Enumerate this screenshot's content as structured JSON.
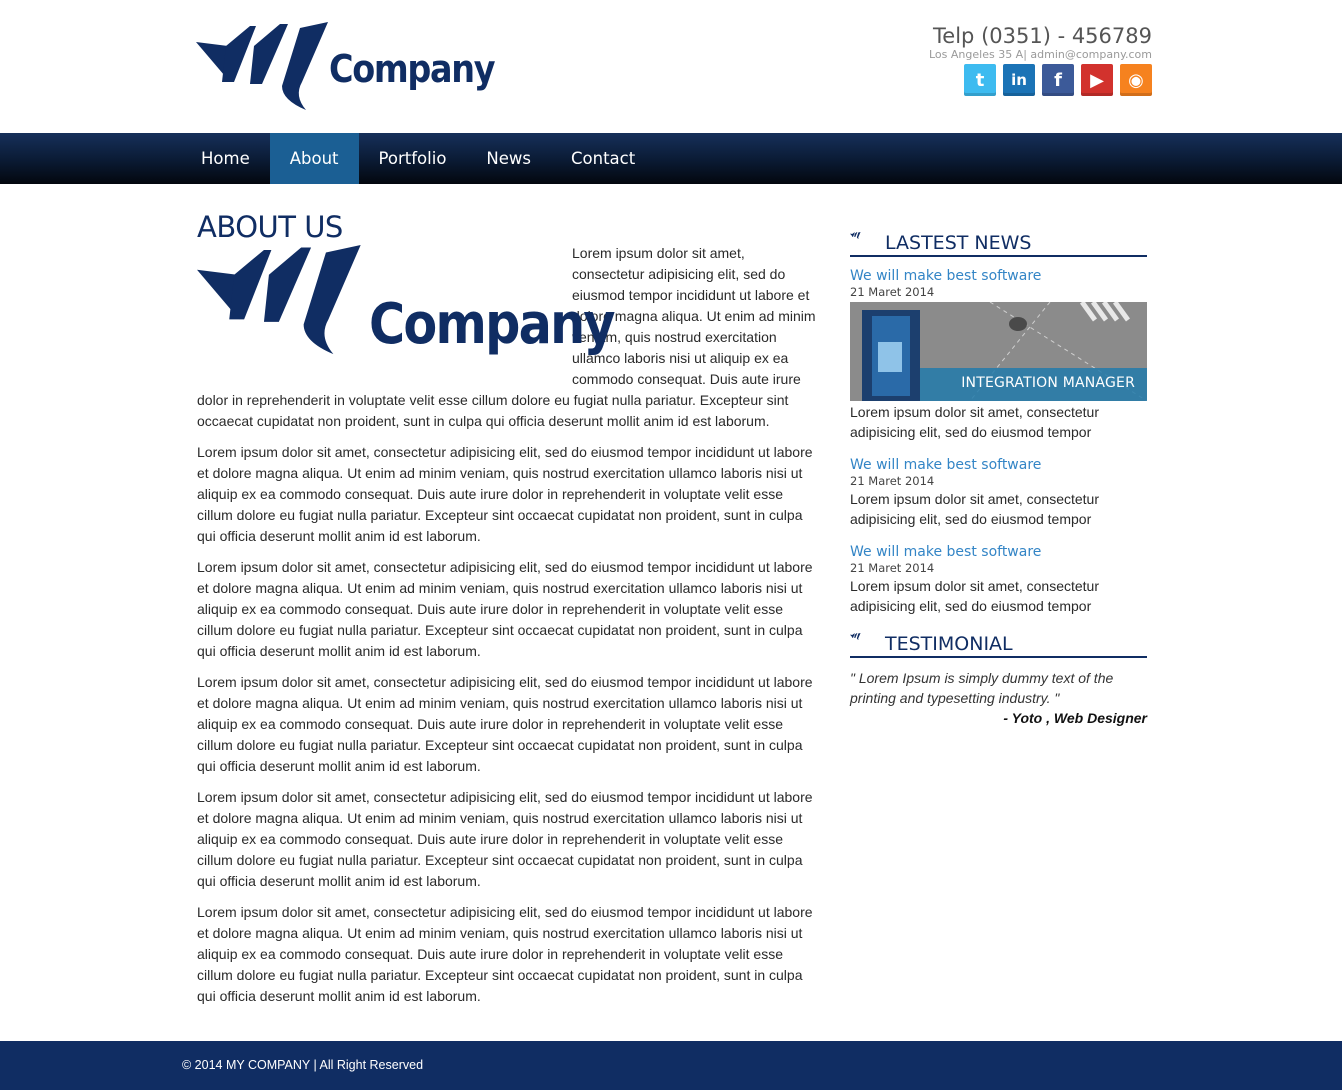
{
  "brand": {
    "name": "Company"
  },
  "header": {
    "phone": "Telp (0351) - 456789",
    "address": "Los Angeles 35 A| admin@company.com",
    "social": [
      {
        "icon": "twitter-icon",
        "glyph": "t",
        "color": "#3dbbf0"
      },
      {
        "icon": "linkedin-icon",
        "glyph": "in",
        "color": "#1b73b6"
      },
      {
        "icon": "facebook-icon",
        "glyph": "f",
        "color": "#3c5a99"
      },
      {
        "icon": "youtube-icon",
        "glyph": "▶",
        "color": "#d2322d"
      },
      {
        "icon": "rss-icon",
        "glyph": "◉",
        "color": "#f6821f"
      }
    ]
  },
  "nav": {
    "items": [
      {
        "label": "Home"
      },
      {
        "label": "About",
        "active": true
      },
      {
        "label": "Portfolio"
      },
      {
        "label": "News"
      },
      {
        "label": "Contact"
      }
    ]
  },
  "main": {
    "title": "ABOUT US",
    "paragraphs": [
      "Lorem ipsum dolor sit amet, consectetur adipisicing elit, sed do eiusmod tempor incididunt ut labore et dolore magna aliqua. Ut enim ad minim veniam, quis nostrud exercitation ullamco laboris nisi ut aliquip ex ea commodo consequat. Duis aute irure dolor in reprehenderit in voluptate velit esse cillum dolore eu fugiat nulla pariatur. Excepteur sint occaecat cupidatat non proident, sunt in culpa qui officia deserunt mollit anim id est laborum.",
      "Lorem ipsum dolor sit amet, consectetur adipisicing elit, sed do eiusmod tempor incididunt ut labore et dolore magna aliqua. Ut enim ad minim veniam, quis nostrud exercitation ullamco laboris nisi ut aliquip ex ea commodo consequat. Duis aute irure dolor in reprehenderit in voluptate velit esse cillum dolore eu fugiat nulla pariatur. Excepteur sint occaecat cupidatat non proident, sunt in culpa qui officia deserunt mollit anim id est laborum.",
      "Lorem ipsum dolor sit amet, consectetur adipisicing elit, sed do eiusmod tempor incididunt ut labore et dolore magna aliqua. Ut enim ad minim veniam, quis nostrud exercitation ullamco laboris nisi ut aliquip ex ea commodo consequat. Duis aute irure dolor in reprehenderit in voluptate velit esse cillum dolore eu fugiat nulla pariatur. Excepteur sint occaecat cupidatat non proident, sunt in culpa qui officia deserunt mollit anim id est laborum.",
      "Lorem ipsum dolor sit amet, consectetur adipisicing elit, sed do eiusmod tempor incididunt ut labore et dolore magna aliqua. Ut enim ad minim veniam, quis nostrud exercitation ullamco laboris nisi ut aliquip ex ea commodo consequat. Duis aute irure dolor in reprehenderit in voluptate velit esse cillum dolore eu fugiat nulla pariatur. Excepteur sint occaecat cupidatat non proident, sunt in culpa qui officia deserunt mollit anim id est laborum.",
      "Lorem ipsum dolor sit amet, consectetur adipisicing elit, sed do eiusmod tempor incididunt ut labore et dolore magna aliqua. Ut enim ad minim veniam, quis nostrud exercitation ullamco laboris nisi ut aliquip ex ea commodo consequat. Duis aute irure dolor in reprehenderit in voluptate velit esse cillum dolore eu fugiat nulla pariatur. Excepteur sint occaecat cupidatat non proident, sunt in culpa qui officia deserunt mollit anim id est laborum.",
      "Lorem ipsum dolor sit amet, consectetur adipisicing elit, sed do eiusmod tempor incididunt ut labore et dolore magna aliqua. Ut enim ad minim veniam, quis nostrud exercitation ullamco laboris nisi ut aliquip ex ea commodo consequat. Duis aute irure dolor in reprehenderit in voluptate velit esse cillum dolore eu fugiat nulla pariatur. Excepteur sint occaecat cupidatat non proident, sunt in culpa qui officia deserunt mollit anim id est laborum."
    ]
  },
  "sidebar": {
    "news_heading": "LASTEST NEWS",
    "news": [
      {
        "title": "We will make best software",
        "date": "21 Maret 2014",
        "excerpt": "Lorem ipsum dolor sit amet, consectetur adipisicing elit, sed do eiusmod tempor",
        "banner_caption": "INTEGRATION MANAGER"
      },
      {
        "title": "We will make best software",
        "date": "21 Maret 2014",
        "excerpt": "Lorem ipsum dolor sit amet, consectetur adipisicing elit, sed do eiusmod tempor"
      },
      {
        "title": "We will make best software",
        "date": "21 Maret 2014",
        "excerpt": "Lorem ipsum dolor sit amet, consectetur adipisicing elit, sed do eiusmod tempor"
      }
    ],
    "testimonial_heading": "TESTIMONIAL",
    "testimonial": {
      "quote": "\" Lorem Ipsum is simply dummy text of the printing and typesetting industry. \"",
      "author": "- Yoto , Web Designer"
    }
  },
  "footer": {
    "copyright": "© 2014 MY COMPANY | All Right Reserved"
  },
  "colors": {
    "brand": "#102d63",
    "nav_active": "#1b5f94",
    "link": "#3385c6",
    "footer": "#102d63"
  }
}
